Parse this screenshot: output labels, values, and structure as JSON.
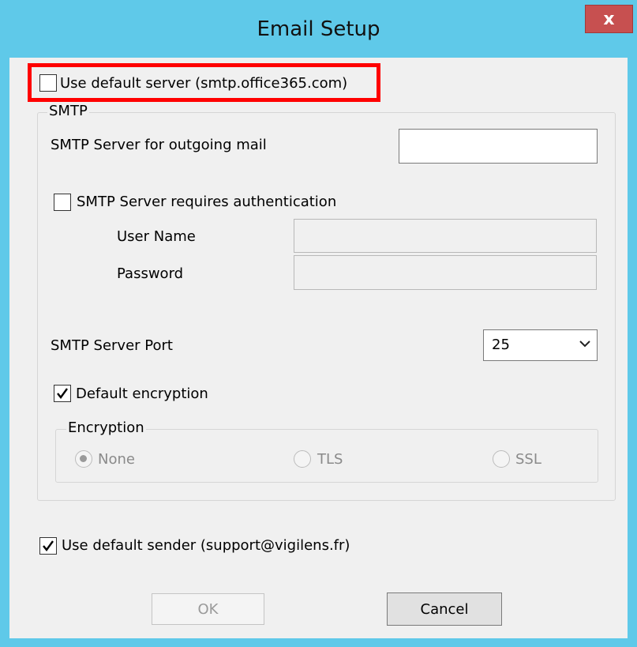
{
  "window": {
    "title": "Email Setup",
    "close_glyph": "x"
  },
  "default_server": {
    "label": "Use default server (smtp.office365.com)",
    "checked": false
  },
  "smtp_group": {
    "title": "SMTP",
    "server_label": "SMTP Server for outgoing mail",
    "server_value": "",
    "auth_label": "SMTP Server requires authentication",
    "auth_checked": false,
    "username_label": "User Name",
    "username_value": "",
    "password_label": "Password",
    "password_value": "",
    "port_label": "SMTP Server Port",
    "port_value": "25",
    "default_encryption_label": "Default encryption",
    "default_encryption_checked": true,
    "encryption": {
      "title": "Encryption",
      "options": [
        "None",
        "TLS",
        "SSL"
      ],
      "selected": "None"
    }
  },
  "default_sender": {
    "label": "Use default sender (support@vigilens.fr)",
    "checked": true
  },
  "buttons": {
    "ok": "OK",
    "cancel": "Cancel"
  },
  "colors": {
    "titlebar": "#5fc9e9",
    "close": "#c75050",
    "highlight": "#ff0000"
  }
}
